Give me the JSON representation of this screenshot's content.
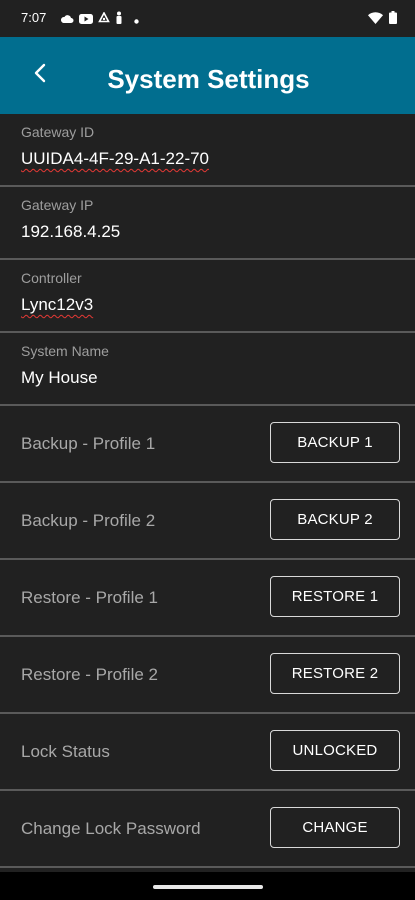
{
  "status_bar": {
    "time": "7:07",
    "left_icons": [
      "cloud-icon",
      "youtube-icon",
      "recycle-icon",
      "person-icon",
      "dot-icon"
    ],
    "right_icons": [
      "wifi-icon",
      "battery-icon"
    ]
  },
  "header": {
    "title": "System Settings",
    "back_icon": "chevron-left-icon",
    "background": "#016e8f"
  },
  "fields": [
    {
      "label": "Gateway ID",
      "value": "UUIDA4-4F-29-A1-22-70"
    },
    {
      "label": "Gateway IP",
      "value": "192.168.4.25"
    },
    {
      "label": "Controller",
      "value": "Lync12v3"
    },
    {
      "label": "System Name",
      "value": "My House"
    }
  ],
  "rows": [
    {
      "label": "Backup - Profile 1",
      "button": "BACKUP 1"
    },
    {
      "label": "Backup - Profile 2",
      "button": "BACKUP 2"
    },
    {
      "label": "Restore - Profile 1",
      "button": "RESTORE 1"
    },
    {
      "label": "Restore - Profile 2",
      "button": "RESTORE 2"
    },
    {
      "label": "Lock Status",
      "button": "UNLOCKED"
    },
    {
      "label": "Change Lock Password",
      "button": "CHANGE"
    }
  ],
  "colors": {
    "background": "#212121",
    "divider": "#5a5a5a",
    "label": "#9e9e9e",
    "spellcheck": "#e53935"
  }
}
